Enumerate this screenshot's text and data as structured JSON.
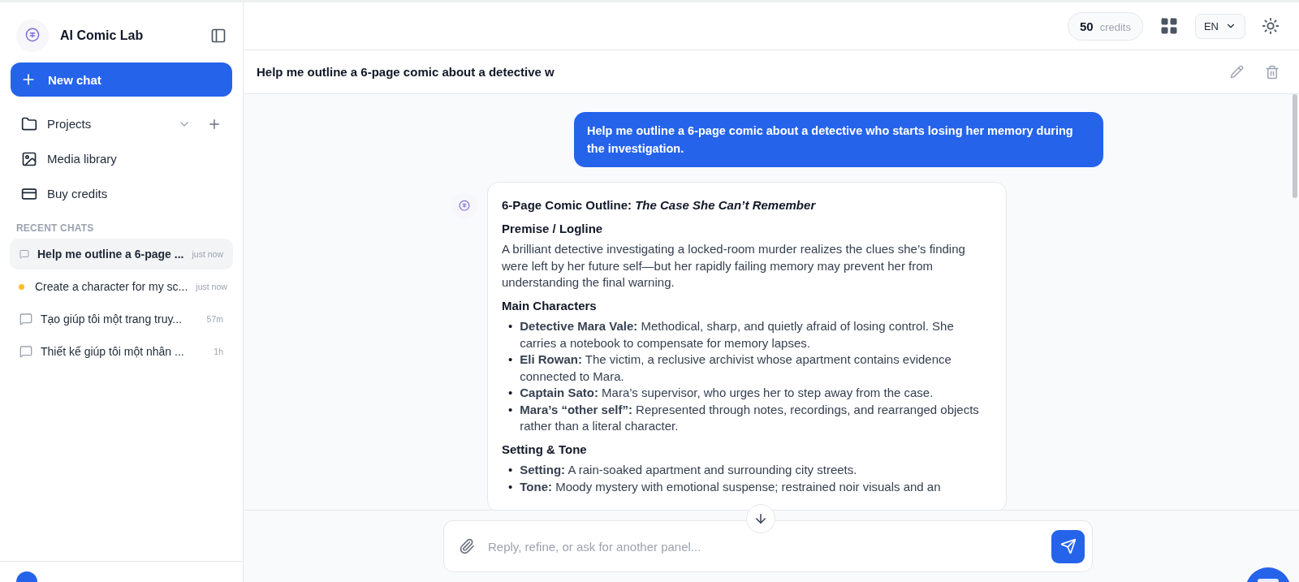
{
  "sidebar": {
    "app_title": "AI Comic Lab",
    "new_chat": "New chat",
    "nav": [
      {
        "kind": "projects",
        "label": "Projects"
      },
      {
        "kind": "media",
        "label": "Media library"
      },
      {
        "kind": "credits",
        "label": "Buy credits"
      }
    ],
    "recent_heading": "RECENT CHATS",
    "recent": [
      {
        "title": "Help me outline a 6-page ...",
        "time": "just now",
        "selected": true,
        "kind": "chat"
      },
      {
        "title": "Create a character for my sc...",
        "time": "just now",
        "selected": false,
        "kind": "dot",
        "color": "#fbbf24"
      },
      {
        "title": "Tạo giúp tôi một trang truy...",
        "time": "57m",
        "selected": false,
        "kind": "chat"
      },
      {
        "title": "Thiết kế giúp tôi một nhân ...",
        "time": "1h",
        "selected": false,
        "kind": "chat"
      }
    ]
  },
  "header": {
    "credits_count": "50",
    "credits_label": "credits",
    "language": "EN"
  },
  "chat": {
    "title": "Help me outline a 6-page comic about a detective w",
    "user_message": "Help me outline a 6-page comic about a detective who starts losing her memory during the investigation.",
    "reply": [
      {
        "kind": "title",
        "text": "6-Page Comic Outline: *The Case She Can’t Remember*"
      },
      {
        "kind": "heading",
        "text": "Premise / Logline"
      },
      {
        "kind": "paragraph",
        "text": "A brilliant detective investigating a locked-room murder realizes the clues she’s finding were left by her future self—but her rapidly failing memory may prevent her from understanding the final warning."
      },
      {
        "kind": "heading",
        "text": "Main Characters"
      },
      {
        "kind": "list",
        "bullet": "•",
        "items": [
          "**Detective Mara Vale:** Methodical, sharp, and quietly afraid of losing control. She carries a notebook to compensate for memory lapses.",
          "**Eli Rowan:** The victim, a reclusive archivist whose apartment contains evidence connected to Mara.",
          "**Captain Sato:** Mara’s supervisor, who urges her to step away from the case.",
          "**Mara’s “other self”:** Represented through notes, recordings, and rearranged objects rather than a literal character."
        ]
      },
      {
        "kind": "heading",
        "text": "Setting & Tone"
      },
      {
        "kind": "list",
        "bullet": "•",
        "items": [
          "**Setting:** A rain-soaked apartment and surrounding city streets.",
          "**Tone:** Moody mystery with emotional suspense; restrained noir visuals and an"
        ]
      }
    ]
  },
  "composer": {
    "placeholder": "Reply, refine, or ask for another panel..."
  }
}
